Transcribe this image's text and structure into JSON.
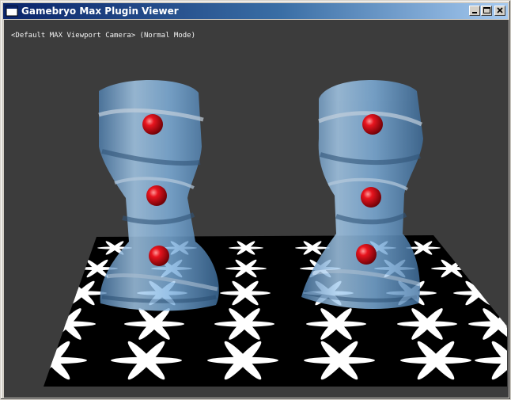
{
  "window": {
    "title": "Gamebryo Max Plugin Viewer",
    "title_bar_gradient": [
      "#0a246a",
      "#a6caf0"
    ],
    "chrome_color": "#d4d0c8"
  },
  "title_buttons": {
    "minimize_icon": "minimize-icon",
    "maximize_icon": "maximize-icon",
    "close_icon": "close-icon"
  },
  "viewport": {
    "camera_label": "<Default MAX Viewport Camera> (Normal Mode)",
    "background_color": "#3c3c3c",
    "scene": {
      "floor_pattern": "white six-petal flowers on black tiles",
      "objects": [
        "twisted glass tower (left)",
        "twisted glass tower (right)"
      ],
      "glass_color": "#7fb2e0",
      "sphere_color": "#d8101a",
      "spheres_per_tower": 3
    }
  }
}
